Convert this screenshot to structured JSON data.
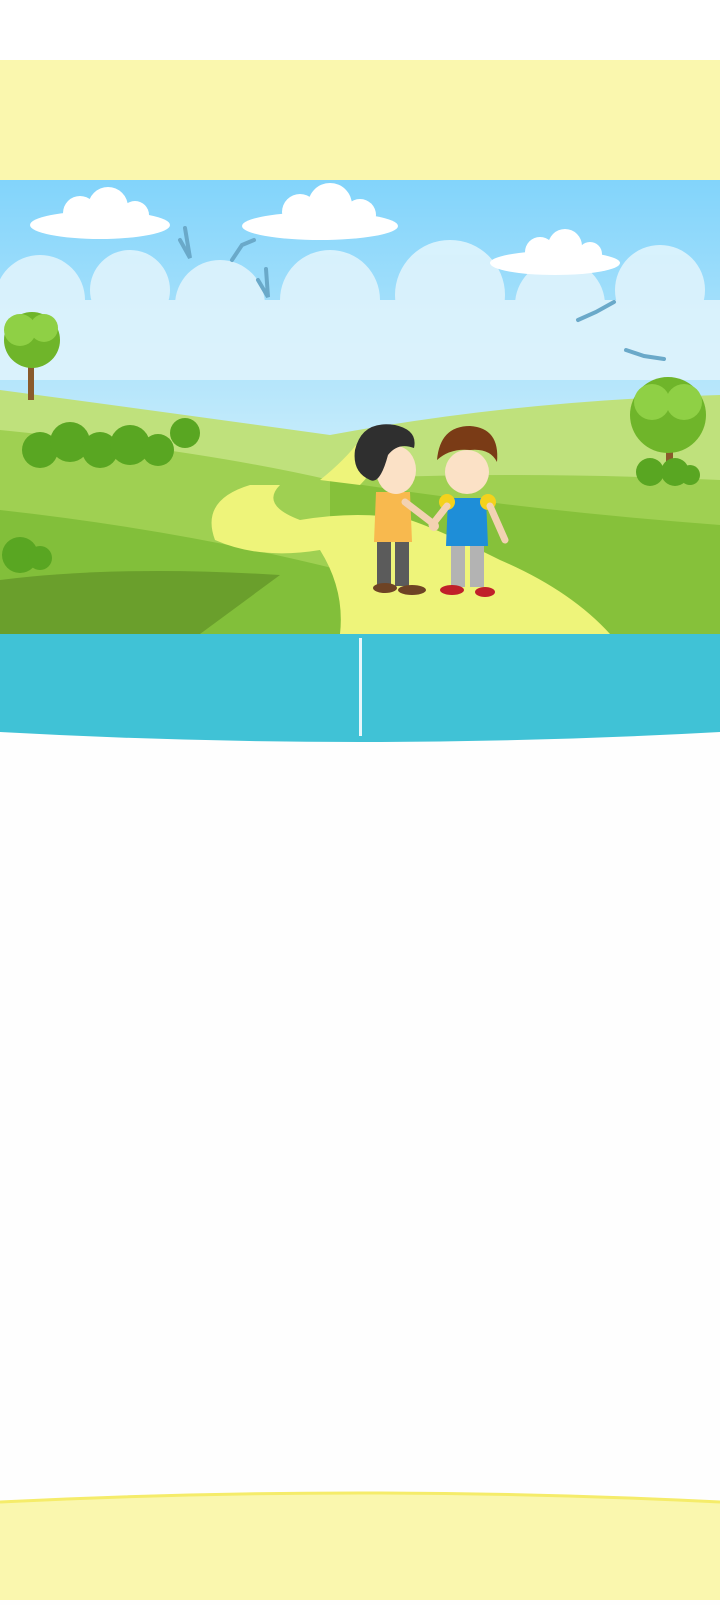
{
  "colors": {
    "top_banner": "#faf7ae",
    "bottom_banner": "#faf7ae",
    "button_bar": "#40c2d6",
    "sky_top": "#84d5fa",
    "grass": "#8fd045",
    "path": "#eef47a"
  },
  "scene": {
    "icon": "two-boys-shaking-hands-illustration"
  },
  "button_bar": {
    "left_label": "",
    "right_label": ""
  }
}
